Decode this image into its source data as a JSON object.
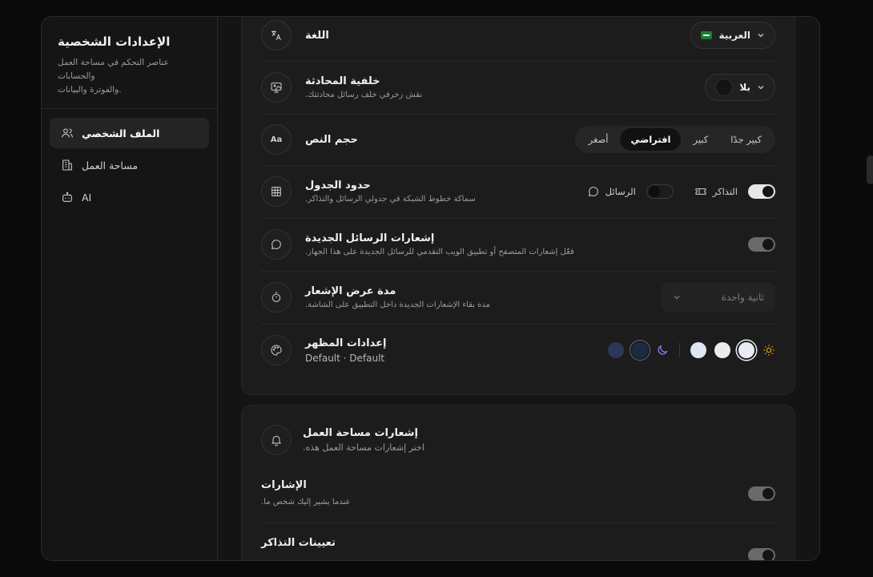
{
  "sidebar": {
    "title": "الإعدادات الشخصية",
    "description_line1": "عناصر التحكم في مساحة العمل والحسابات",
    "description_line2": "والفوترة والبيانات.",
    "items": [
      {
        "label": "الملف الشخصي",
        "icon": "users-icon",
        "active": true
      },
      {
        "label": "مساحة العمل",
        "icon": "building-icon",
        "active": false
      },
      {
        "label": "AI",
        "icon": "bot-icon",
        "active": false
      }
    ]
  },
  "settings": {
    "language": {
      "title": "اللغة",
      "value": "العربية",
      "icon": "translate-icon"
    },
    "chat_background": {
      "title": "خلفية المحادثة",
      "description": "نقش زخرفي خلف رسائل محادثتك.",
      "value": "بلا",
      "icon": "wallpaper-icon"
    },
    "text_size": {
      "title": "حجم النص",
      "icon": "text-size-icon",
      "options": [
        "كبير جدًا",
        "كبير",
        "افتراضي",
        "أصغر"
      ],
      "selected": "افتراضي"
    },
    "table_borders": {
      "title": "حدود الجدول",
      "description": "سماكة خطوط الشبكة في جدولي الرسائل والتذاكر.",
      "icon": "grid-icon",
      "tickets_label": "التذاكر",
      "tickets_on": true,
      "messages_label": "الرسائل",
      "messages_on": false
    },
    "new_message_notifications": {
      "title": "إشعارات الرسائل الجديدة",
      "description": "فعّل إشعارات المتصفح أو تطبيق الويب التقدمي للرسائل الجديدة على هذا الجهاز.",
      "icon": "message-icon",
      "enabled": true
    },
    "notification_duration": {
      "title": "مدة عرض الإشعار",
      "description": "مدة بقاء الإشعارات الجديدة داخل التطبيق على الشاشة.",
      "icon": "timer-icon",
      "value": "ثانية واحدة"
    },
    "appearance": {
      "title": "إعدادات المظهر",
      "subtitle": "Default · Default",
      "icon": "palette-icon",
      "light_swatches": [
        "#e9ecf2",
        "#ececec",
        "#dfe6f3"
      ],
      "dark_swatches": [
        "#1a2540",
        "#26324d"
      ],
      "accent_sun": "#e0a020",
      "accent_moon": "#8a86ff"
    }
  },
  "workspace_notifications": {
    "title": "إشعارات مساحة العمل",
    "description": "اختر إشعارات مساحة العمل هذه.",
    "icon": "bell-icon",
    "mentions": {
      "title": "الإشارات",
      "description": "عندما يشير إليك شخص ما.",
      "enabled": true
    },
    "ticket_assignments": {
      "title": "تعيينات التذاكر",
      "enabled": true
    }
  }
}
